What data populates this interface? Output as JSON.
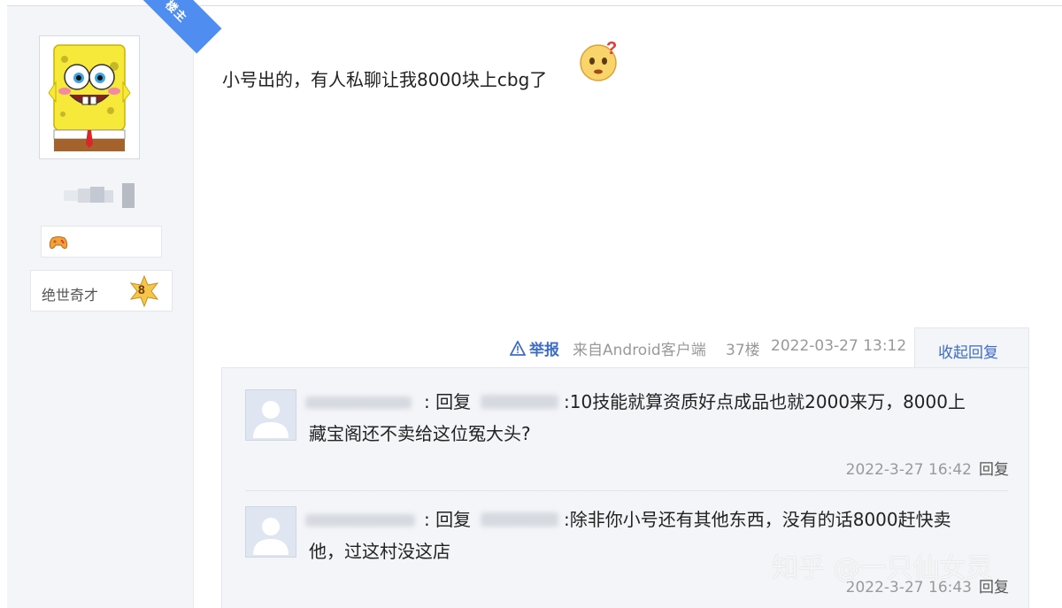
{
  "author": {
    "role_badge": "楼主",
    "level_title": "绝世奇才",
    "level_number": "8"
  },
  "post": {
    "content": "小号出的，有人私聊让我8000块上cbg了"
  },
  "meta": {
    "report_label": "举报",
    "source": "来自Android客户端",
    "floor": "37楼",
    "timestamp": "2022-03-27 13:12",
    "collapse_label": "收起回复"
  },
  "replies": [
    {
      "reply_prefix": ":",
      "reply_word": "回复",
      "text_line1": ":10技能就算资质好点成品也就2000来万，8000上",
      "text_line2": "藏宝阁还不卖给这位冤大头?",
      "time": "2022-3-27 16:42",
      "reply_link": "回复"
    },
    {
      "reply_prefix": ":",
      "reply_word": "回复",
      "text_line1": ":除非你小号还有其他东西，没有的话8000赶快卖",
      "text_line2": "他，过这村没这店",
      "time": "2022-3-27 16:43",
      "reply_link": "回复"
    }
  ],
  "watermark": "知乎 @一只仙女灵",
  "colors": {
    "link_blue": "#3c6cc8",
    "ribbon_blue": "#4f8ef0",
    "panel_gray": "#f4f5f8"
  }
}
